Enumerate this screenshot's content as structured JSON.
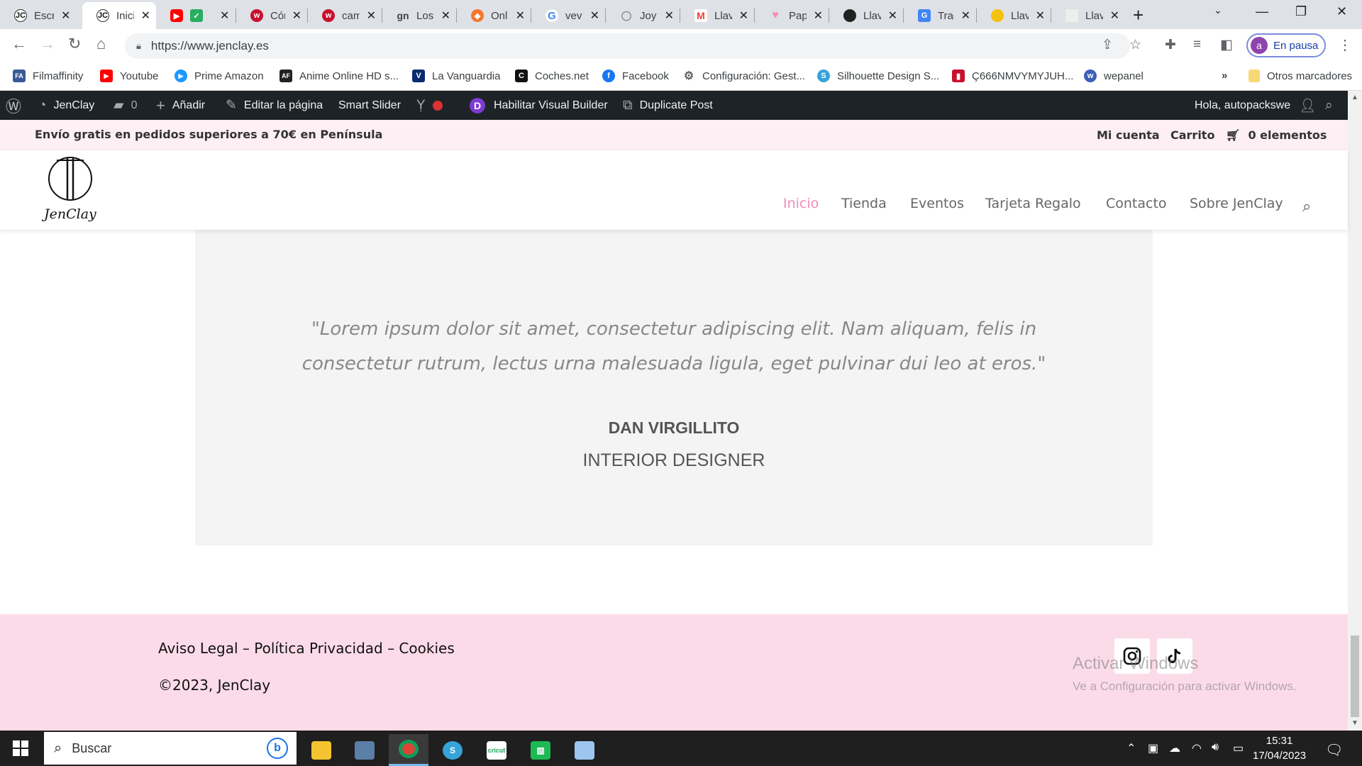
{
  "browser": {
    "tabs": [
      {
        "label": "Escr",
        "favicon": "jenclay-logo",
        "color": "#ffffff"
      },
      {
        "label": "Inici",
        "favicon": "jenclay-logo",
        "color": "#ffffff"
      },
      {
        "label": "",
        "favicon": "youtube-and-check",
        "color": "#ff0000"
      },
      {
        "label": "Cóm",
        "favicon": "wallapop-w",
        "color": "#c8102e"
      },
      {
        "label": "cam",
        "favicon": "wallapop-w",
        "color": "#c8102e"
      },
      {
        "label": "Los",
        "favicon": "gn-logo",
        "color": "#444444"
      },
      {
        "label": "Onl",
        "favicon": "brave-lion",
        "color": "#f4772c"
      },
      {
        "label": "vev",
        "favicon": "google-g",
        "color": "#4285f4"
      },
      {
        "label": "Joy",
        "favicon": "ring",
        "color": "#888888"
      },
      {
        "label": "Llav",
        "favicon": "gmail-m",
        "color": "#ea4335"
      },
      {
        "label": "Pap",
        "favicon": "heart",
        "color": "#f48fb1"
      },
      {
        "label": "Llav",
        "favicon": "black-circle",
        "color": "#222222"
      },
      {
        "label": "Trac",
        "favicon": "translate",
        "color": "#4285f4"
      },
      {
        "label": "Llav",
        "favicon": "banana",
        "color": "#f4c20d"
      },
      {
        "label": "Llav",
        "favicon": "page",
        "color": "#dddddd"
      }
    ],
    "url": "https://www.jenclay.es",
    "profile_label": "En pausa",
    "profile_initial": "a",
    "bookmarks": [
      {
        "label": "Filmaffinity",
        "color": "#3b5998",
        "glyph": "FA"
      },
      {
        "label": "Youtube",
        "color": "#ff0000",
        "glyph": "▶"
      },
      {
        "label": "Prime Amazon",
        "color": "#1a98ff",
        "glyph": "▶"
      },
      {
        "label": "Anime Online HD s...",
        "color": "#222222",
        "glyph": "AF"
      },
      {
        "label": "La Vanguardia",
        "color": "#0a2c6e",
        "glyph": "V"
      },
      {
        "label": "Coches.net",
        "color": "#111111",
        "glyph": "C"
      },
      {
        "label": "Facebook",
        "color": "#1877f2",
        "glyph": "f"
      },
      {
        "label": "Configuración: Gest...",
        "color": "#5f6368",
        "glyph": "⚙"
      },
      {
        "label": "Silhouette Design S...",
        "color": "#36a3d9",
        "glyph": "S"
      },
      {
        "label": "Ç666NMVYMYJUH...",
        "color": "#c8102e",
        "glyph": "▮"
      },
      {
        "label": "wepanel",
        "color": "#3c5fb8",
        "glyph": "w"
      }
    ],
    "more_bookmarks": "»",
    "other_bookmarks": "Otros marcadores"
  },
  "wp_admin": {
    "site_name": "JenClay",
    "comments_count": "0",
    "add_new": "Añadir",
    "edit_page": "Editar la página",
    "smart_slider": "Smart Slider",
    "visual_builder": "Habilitar Visual Builder",
    "duplicate_post": "Duplicate Post",
    "greeting": "Hola, autopackswe"
  },
  "site": {
    "promo": "Envío gratis en pedidos superiores a 70€ en Península",
    "my_account": "Mi cuenta",
    "cart": "Carrito",
    "cart_items": "0 elementos",
    "logo_text": "JenClay",
    "nav": [
      "Inicio",
      "Tienda",
      "Eventos",
      "Tarjeta Regalo",
      "Contacto",
      "Sobre JenClay"
    ],
    "active_nav": "Inicio",
    "accent_color": "#f08bb8"
  },
  "testimonial": {
    "quote": "\"Lorem ipsum dolor sit amet, consectetur adipiscing elit. Nam aliquam, felis in consectetur rutrum, lectus urna malesuada ligula, eget pulvinar dui leo at eros.\"",
    "author": "DAN VIRGILLITO",
    "position": "INTERIOR DESIGNER"
  },
  "footer": {
    "legal": "Aviso Legal – Política Privacidad – Cookies",
    "copyright": "©2023,  JenClay",
    "social": [
      "instagram-icon",
      "tiktok-icon"
    ],
    "watermark_title": "Activar Windows",
    "watermark_text": "Ve a Configuración para activar Windows."
  },
  "taskbar": {
    "search_placeholder": "Buscar",
    "time": "15:31",
    "date": "17/04/2023"
  }
}
